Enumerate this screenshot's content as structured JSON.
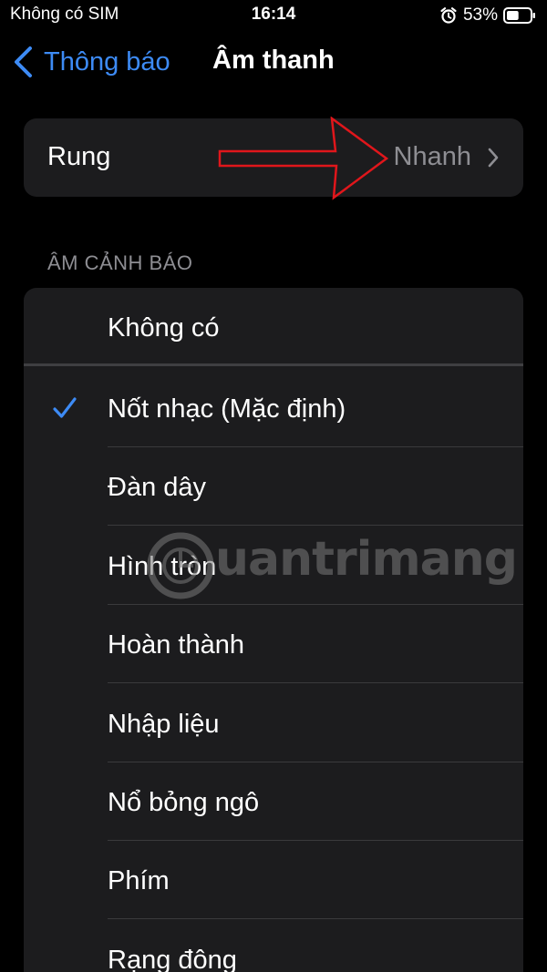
{
  "status_bar": {
    "carrier": "Không có SIM",
    "time": "16:14",
    "battery_percent": "53%",
    "battery_level": 0.53,
    "icons": [
      "alarm-icon",
      "battery-icon"
    ]
  },
  "nav": {
    "back_label": "Thông báo",
    "title": "Âm thanh",
    "accent_color": "#3d8bf5"
  },
  "vibration": {
    "label": "Rung",
    "value": "Nhanh"
  },
  "alert_section": {
    "header": "ÂM CẢNH BÁO",
    "items": [
      {
        "label": "Không có",
        "selected": false
      },
      {
        "label": "Nốt nhạc (Mặc định)",
        "selected": true
      },
      {
        "label": "Đàn dây",
        "selected": false
      },
      {
        "label": "Hình tròn",
        "selected": false
      },
      {
        "label": "Hoàn thành",
        "selected": false
      },
      {
        "label": "Nhập liệu",
        "selected": false
      },
      {
        "label": "Nổ bỏng ngô",
        "selected": false
      },
      {
        "label": "Phím",
        "selected": false
      },
      {
        "label": "Rạng đông",
        "selected": false
      }
    ]
  },
  "watermark": {
    "text": "uantrimang"
  },
  "colors": {
    "background": "#000000",
    "card": "#1c1c1e",
    "secondary_text": "#8e8e93",
    "annotation_arrow": "#e0161b"
  }
}
